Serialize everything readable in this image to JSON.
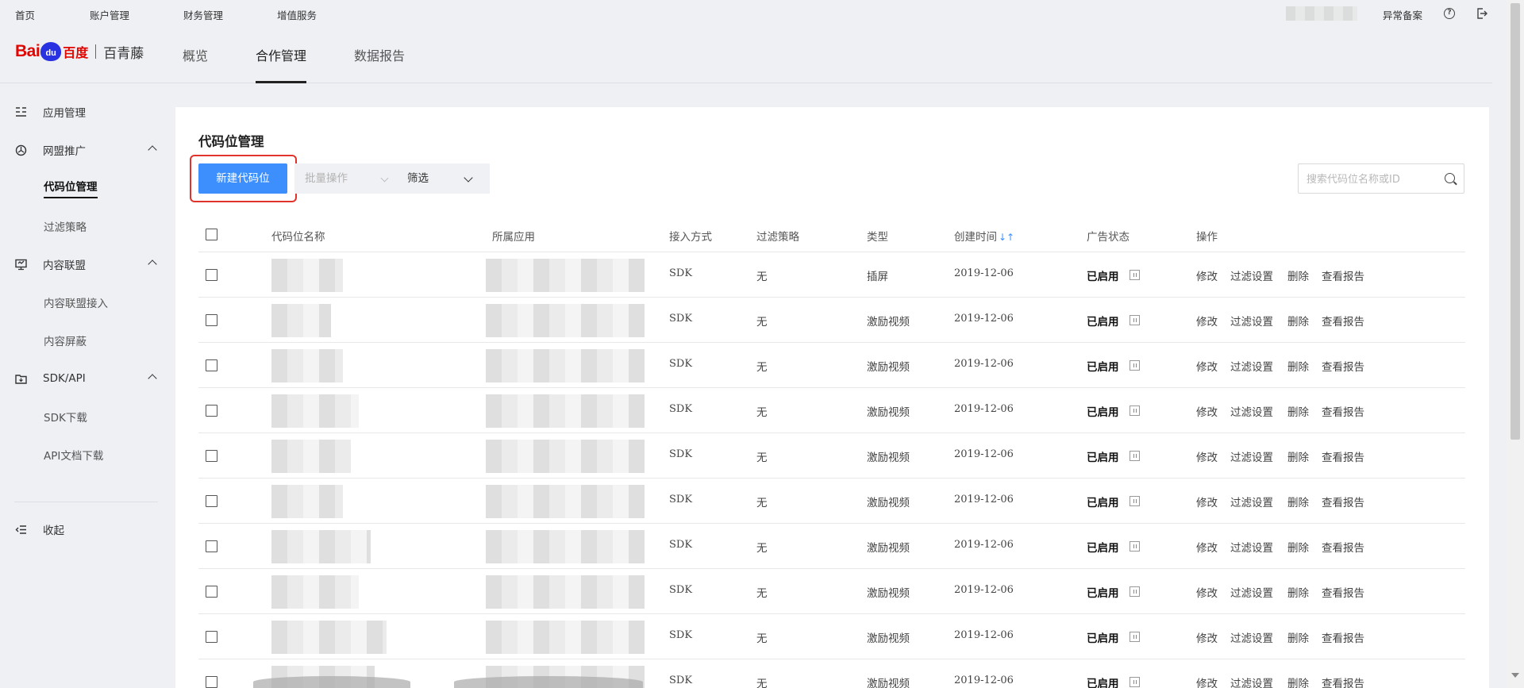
{
  "topbar": {
    "links": [
      "首页",
      "账户管理",
      "财务管理",
      "增值服务"
    ],
    "anomaly_record": "异常备案",
    "help_icon": "question-circle-icon",
    "logout_icon": "logout-icon"
  },
  "header": {
    "logo_bai": "Bai",
    "logo_du": "du",
    "logo_cn": "百度",
    "product": "百青藤",
    "nav": [
      "概览",
      "合作管理",
      "数据报告"
    ],
    "active_nav": "合作管理"
  },
  "sidebar": {
    "app_manage": "应用管理",
    "alliance": "网盟推广",
    "alliance_items": [
      "代码位管理",
      "过滤策略"
    ],
    "content_alliance": "内容联盟",
    "content_items": [
      "内容联盟接入",
      "内容屏蔽"
    ],
    "sdk_api": "SDK/API",
    "sdk_items": [
      "SDK下载",
      "API文档下载"
    ],
    "collapse": "收起"
  },
  "main": {
    "title": "代码位管理",
    "new_button": "新建代码位",
    "batch_button": "批量操作",
    "filter_button": "筛选",
    "search_placeholder": "搜索代码位名称或ID",
    "columns": [
      "代码位名称",
      "所属应用",
      "接入方式",
      "过滤策略",
      "类型",
      "创建时间",
      "广告状态",
      "操作"
    ],
    "actions": [
      "修改",
      "过滤设置",
      "删除",
      "查看报告"
    ],
    "rows": [
      {
        "access": "SDK",
        "filter": "无",
        "type": "插屏",
        "created": "2019-12-06",
        "status": "已启用"
      },
      {
        "access": "SDK",
        "filter": "无",
        "type": "激励视频",
        "created": "2019-12-06",
        "status": "已启用"
      },
      {
        "access": "SDK",
        "filter": "无",
        "type": "激励视频",
        "created": "2019-12-06",
        "status": "已启用"
      },
      {
        "access": "SDK",
        "filter": "无",
        "type": "激励视频",
        "created": "2019-12-06",
        "status": "已启用"
      },
      {
        "access": "SDK",
        "filter": "无",
        "type": "激励视频",
        "created": "2019-12-06",
        "status": "已启用"
      },
      {
        "access": "SDK",
        "filter": "无",
        "type": "激励视频",
        "created": "2019-12-06",
        "status": "已启用"
      },
      {
        "access": "SDK",
        "filter": "无",
        "type": "激励视频",
        "created": "2019-12-06",
        "status": "已启用"
      },
      {
        "access": "SDK",
        "filter": "无",
        "type": "激励视频",
        "created": "2019-12-06",
        "status": "已启用"
      },
      {
        "access": "SDK",
        "filter": "无",
        "type": "激励视频",
        "created": "2019-12-06",
        "status": "已启用"
      },
      {
        "access": "SDK",
        "filter": "无",
        "type": "激励视频",
        "created": "2019-12-06",
        "status": "已启用"
      }
    ]
  },
  "colors": {
    "primary": "#3c8ffd",
    "highlight": "#e0332e",
    "brand_red": "#e10601",
    "brand_blue": "#2932e1"
  }
}
